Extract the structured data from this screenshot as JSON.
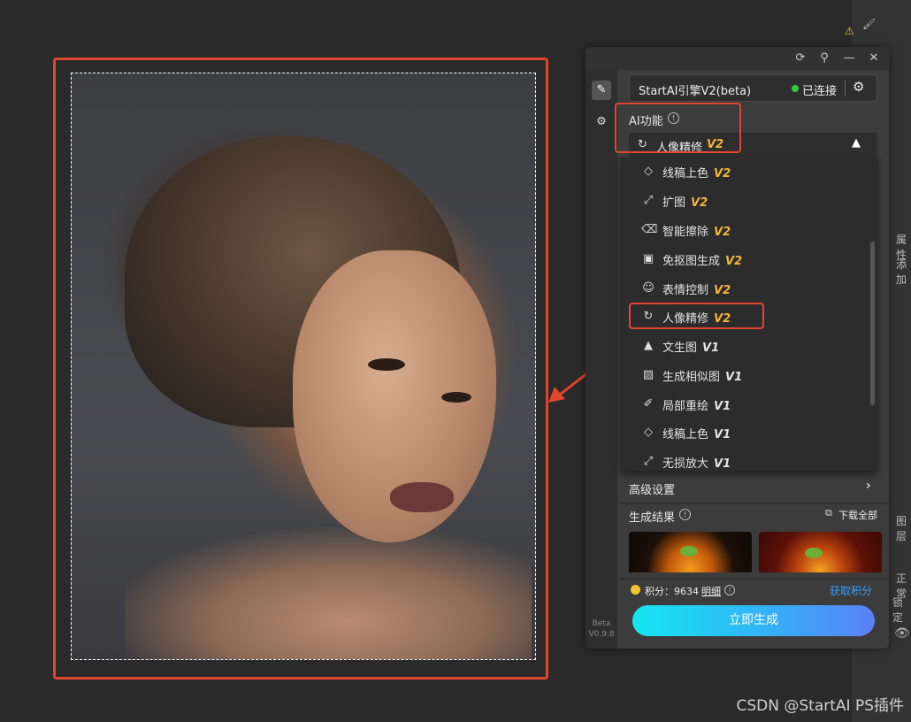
{
  "ps_strip": {
    "label_1": "属性",
    "label_2": "添加",
    "label_3": "图层",
    "label_4": "正常",
    "label_5": "锁定"
  },
  "panel": {
    "titlebar_icons": [
      "refresh-icon",
      "pin-icon",
      "minimize-icon",
      "close-icon"
    ],
    "engine": {
      "name": "StartAI引擎V2(beta)",
      "status": "已连接",
      "status_color": "#2ecc40"
    },
    "ai_section": {
      "title": "AI功能",
      "selected_label": "人像精修",
      "selected_version": "V2"
    },
    "dropdown_items": [
      {
        "label": "线稿上色",
        "version": "V2",
        "icon": "paint-bucket-icon"
      },
      {
        "label": "扩图",
        "version": "V2",
        "icon": "expand-icon"
      },
      {
        "label": "智能擦除",
        "version": "V2",
        "icon": "eraser-icon"
      },
      {
        "label": "免抠图生成",
        "version": "V2",
        "icon": "cutout-icon"
      },
      {
        "label": "表情控制",
        "version": "V2",
        "icon": "smile-icon"
      },
      {
        "label": "人像精修",
        "version": "V2",
        "icon": "portrait-icon"
      },
      {
        "label": "文生图",
        "version": "V1",
        "icon": "image-icon"
      },
      {
        "label": "生成相似图",
        "version": "V1",
        "icon": "similar-image-icon"
      },
      {
        "label": "局部重绘",
        "version": "V1",
        "icon": "brush-icon"
      },
      {
        "label": "线稿上色",
        "version": "V1",
        "icon": "paint-bucket-icon"
      },
      {
        "label": "无损放大",
        "version": "V1",
        "icon": "upscale-icon"
      }
    ],
    "advanced": {
      "label": "高级设置"
    },
    "results": {
      "title": "生成结果",
      "download_all": "下载全部"
    },
    "points": {
      "label": "积分：9634",
      "detail": "明细",
      "get_points": "获取积分"
    },
    "generate_button": "立即生成",
    "version_tag": {
      "line1": "Beta",
      "line2": "V0.9.8"
    }
  },
  "watermark": "CSDN @StartAI PS插件",
  "colors": {
    "accent_red": "#e2452e",
    "v2_gold": "#f4b63a",
    "link_blue": "#3aa0ff"
  }
}
